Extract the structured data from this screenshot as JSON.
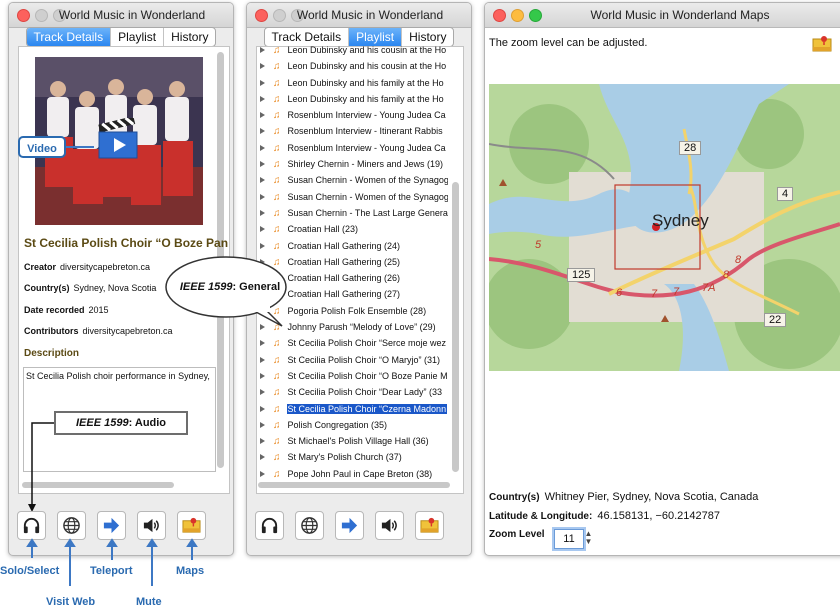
{
  "window1": {
    "title": "World Music in Wonderland",
    "tabs": [
      "Track Details",
      "Playlist",
      "History"
    ],
    "track_title": "St Cecilia Polish Choir “O Boze Pan",
    "creator_label": "Creator",
    "creator_value": "diversitycapebreton.ca",
    "country_label": "Country(s)",
    "country_value": "Sydney, Nova Scotia",
    "date_label": "Date recorded",
    "date_value": "2015",
    "contributors_label": "Contributors",
    "contributors_value": "diversitycapebreton.ca",
    "description_label": "Description",
    "description_value": "St Cecilia Polish choir performance in Sydney,",
    "video_label": "Video"
  },
  "window2": {
    "title": "World Music in Wonderland",
    "tabs": [
      "Track Details",
      "Playlist",
      "History"
    ],
    "items": [
      "Leon Dubinsky and his cousin at the Ho",
      "Leon Dubinsky and his cousin at the Ho",
      "Leon Dubinsky and his family at the Ho",
      "Leon Dubinsky and his family at the Ho",
      "Rosenblum Interview - Young Judea Ca",
      "Rosenblum Interview - Itinerant Rabbis",
      "Rosenblum Interview - Young Judea Ca",
      "Shirley Chernin - Miners and Jews (19)",
      "Susan Chernin - Women of the Synagog",
      "Susan Chernin - Women of the Synagog",
      "Susan Chernin - The Last Large Genera",
      "Croatian Hall (23)",
      "Croatian Hall Gathering (24)",
      "Croatian Hall Gathering (25)",
      "Croatian Hall Gathering (26)",
      "Croatian Hall Gathering (27)",
      "Pogoria Polish Folk Ensemble (28)",
      "Johnny Parush “Melody of Love” (29)",
      "St Cecilia Polish Choir “Serce moje wez",
      "St Cecilia Polish Choir “O Maryjo” (31)",
      "St Cecilia Polish Choir “O Boze Panie M",
      "St Cecilia Polish Choir “Dear Lady” (33",
      "St Cecilia Polish Choir “Czerna Madonn",
      "Polish Congregation (35)",
      "St Michael's Polish Village Hall (36)",
      "St Mary's Polish Church (37)",
      "Pope John Paul in Cape Breton (38)"
    ],
    "selected_index": 22
  },
  "window3": {
    "title": "World Music in Wonderland Maps",
    "zoom_note": "The zoom level can be adjusted.",
    "country_label": "Country(s)",
    "country_value": "Whitney Pier, Sydney, Nova Scotia, Canada",
    "latlng_label": "Latitude & Longitude:",
    "latlng_value": "46.158131, −60.2142787",
    "zoom_label": "Zoom Level",
    "zoom_value": "11",
    "map": {
      "city": "Sydney",
      "route_labels": [
        "28",
        "4",
        "5",
        "125",
        "6",
        "7",
        "7",
        "7A",
        "8",
        "8",
        "22"
      ]
    }
  },
  "callouts": {
    "general_bold": "IEEE 1599",
    "general_rest": ": General",
    "audio_bold": "IEEE 1599",
    "audio_rest": ": Audio"
  },
  "annotations": {
    "solo": "Solo/Select",
    "visit": "Visit Web",
    "teleport": "Teleport",
    "mute": "Mute",
    "maps": "Maps"
  },
  "icons": [
    "headphones-icon",
    "globe-icon",
    "arrow-right-icon",
    "speaker-icon",
    "map-icon"
  ],
  "colors": {
    "accent": "#2a86f0",
    "selection": "#1a57c8",
    "annotation": "#2a6ab0",
    "heading": "#5b4a14"
  }
}
